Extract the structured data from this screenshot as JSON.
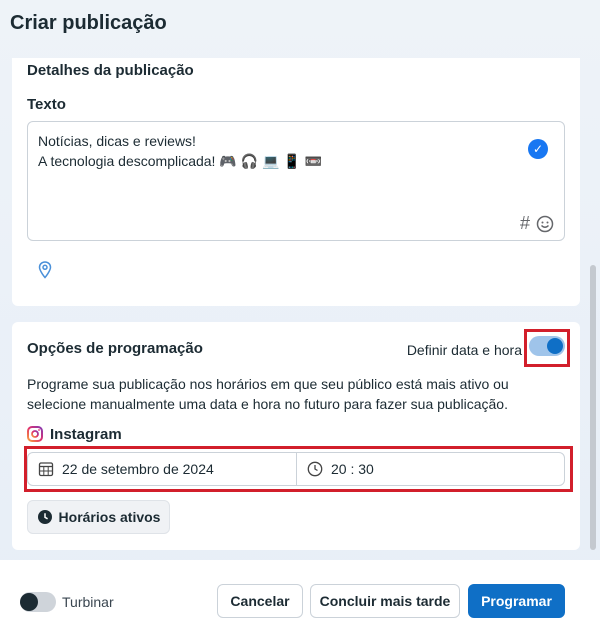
{
  "page": {
    "title": "Criar publicação"
  },
  "details": {
    "title": "Detalhes da publicação",
    "text_label": "Texto",
    "text_lines": [
      "Notícias, dicas e reviews!",
      "A tecnologia descomplicada! 🎮 🎧 💻 📱 📼"
    ]
  },
  "schedule": {
    "title": "Opções de programação",
    "toggle_label": "Definir data e hora",
    "toggle_on": true,
    "description": "Programe sua publicação nos horários em que seu público está mais ativo ou selecione manualmente uma data e hora no futuro para fazer sua publicação.",
    "platform": "Instagram",
    "date": "22 de setembro de 2024",
    "time": "20 : 30",
    "active_hours_label": "Horários ativos"
  },
  "footer": {
    "boost_label": "Turbinar",
    "boost_on": false,
    "cancel_label": "Cancelar",
    "later_label": "Concluir mais tarde",
    "schedule_label": "Programar"
  },
  "colors": {
    "primary": "#0f6fc6",
    "highlight": "#d21f2b"
  },
  "icons": {
    "check": "check-circle-icon",
    "hashtag": "hashtag-icon",
    "emoji": "emoji-icon",
    "location": "location-pin-icon",
    "instagram": "instagram-icon",
    "calendar": "calendar-icon",
    "clock": "clock-icon"
  }
}
